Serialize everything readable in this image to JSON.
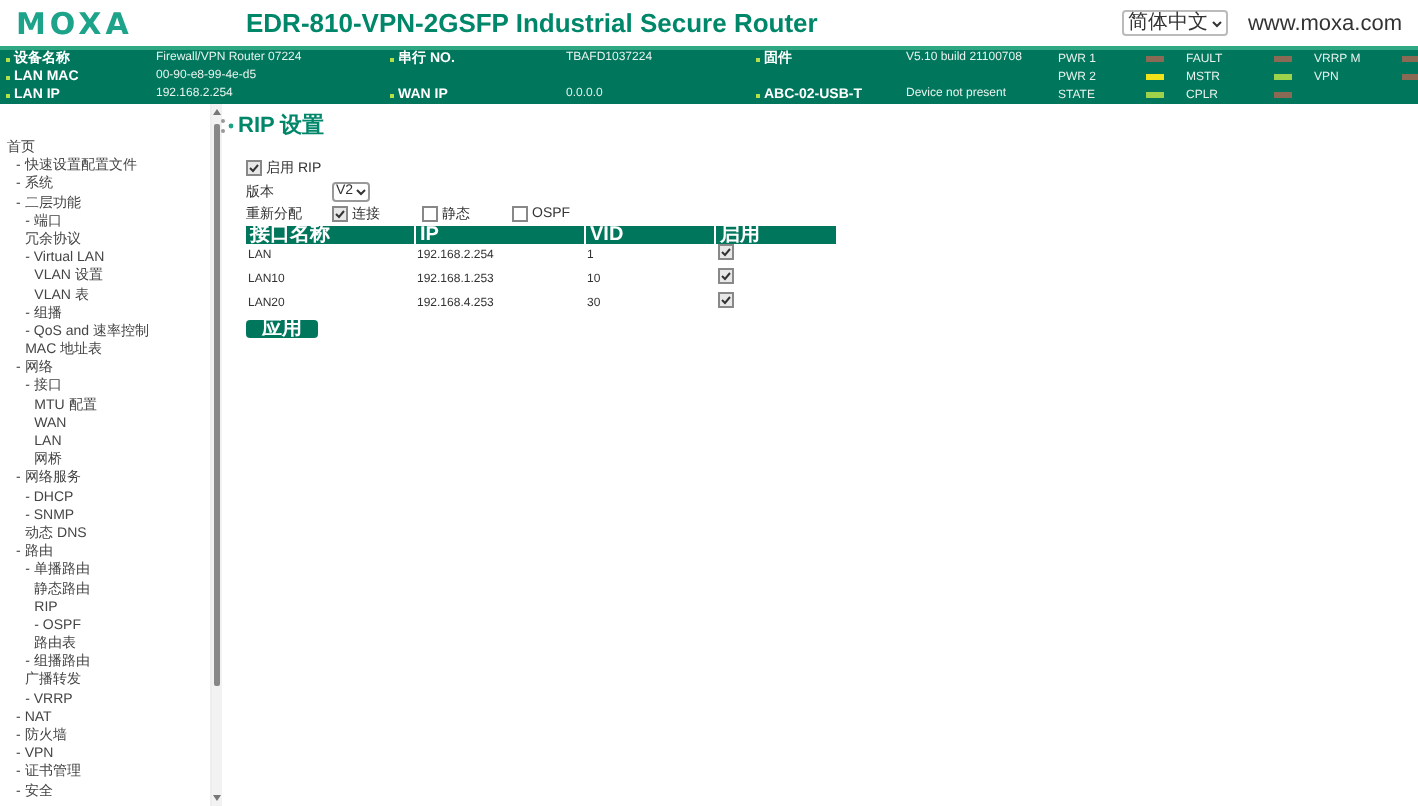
{
  "header": {
    "logo": "MOXA",
    "title": "EDR-810-VPN-2GSFP Industrial Secure Router",
    "language": "简体中文",
    "website": "www.moxa.com"
  },
  "info_rows": [
    [
      {
        "label": "设备名称",
        "value": "Firewall/VPN Router 07224"
      },
      {
        "label": "串行 NO.",
        "value": "TBAFD1037224"
      },
      {
        "label": "固件",
        "value": "V5.10 build 21100708"
      }
    ],
    [
      {
        "label": "LAN MAC",
        "value": "00-90-e8-99-4e-d5"
      }
    ],
    [
      {
        "label": "LAN IP",
        "value": "192.168.2.254"
      },
      {
        "label": "WAN IP",
        "value": "0.0.0.0"
      },
      {
        "label": "ABC-02-USB-T",
        "value": "Device not present"
      }
    ]
  ],
  "leds": [
    [
      {
        "label": "PWR 1",
        "color": "#8a6a55"
      },
      {
        "label": "PWR 2",
        "color": "#f2e21a"
      },
      {
        "label": "STATE",
        "color": "#9ed24a"
      }
    ],
    [
      {
        "label": "FAULT",
        "color": "#8a6a55"
      },
      {
        "label": "MSTR",
        "color": "#9ed24a"
      },
      {
        "label": "CPLR",
        "color": "#8a6a55"
      }
    ],
    [
      {
        "label": "VRRP M",
        "color": "#8a6a55"
      },
      {
        "label": "VPN",
        "color": "#8a6a55"
      }
    ]
  ],
  "sidebar": {
    "items": [
      {
        "label": "首页",
        "children": [
          {
            "label": "- 快速设置配置文件"
          },
          {
            "label": "- 系统"
          },
          {
            "label": "- 二层功能",
            "children": [
              {
                "label": "- 端口"
              },
              {
                "label": "冗余协议"
              },
              {
                "label": "- Virtual LAN",
                "children": [
                  {
                    "label": "VLAN 设置"
                  },
                  {
                    "label": "VLAN 表"
                  }
                ]
              },
              {
                "label": "- 组播"
              },
              {
                "label": "- QoS and 速率控制"
              },
              {
                "label": "MAC 地址表"
              }
            ]
          },
          {
            "label": "- 网络",
            "children": [
              {
                "label": "- 接口",
                "children": [
                  {
                    "label": "MTU 配置"
                  },
                  {
                    "label": "WAN"
                  },
                  {
                    "label": "LAN"
                  },
                  {
                    "label": "网桥"
                  }
                ]
              }
            ]
          },
          {
            "label": "- 网络服务",
            "children": [
              {
                "label": "- DHCP"
              },
              {
                "label": "- SNMP"
              },
              {
                "label": "动态 DNS"
              }
            ]
          },
          {
            "label": "- 路由",
            "children": [
              {
                "label": "- 单播路由",
                "children": [
                  {
                    "label": "静态路由"
                  },
                  {
                    "label": "RIP"
                  },
                  {
                    "label": "- OSPF"
                  },
                  {
                    "label": "路由表"
                  }
                ]
              },
              {
                "label": "- 组播路由"
              },
              {
                "label": "广播转发"
              },
              {
                "label": "- VRRP"
              }
            ]
          },
          {
            "label": "- NAT"
          },
          {
            "label": "- 防火墙"
          },
          {
            "label": "- VPN"
          },
          {
            "label": "- 证书管理"
          },
          {
            "label": "- 安全"
          }
        ]
      }
    ]
  },
  "page": {
    "title": "RIP 设置",
    "enable": {
      "label": "启用 RIP",
      "checked": true
    },
    "version": {
      "label": "版本",
      "value": "V2"
    },
    "redistribute": {
      "label": "重新分配",
      "options": [
        {
          "label": "连接",
          "checked": true
        },
        {
          "label": "静态",
          "checked": false
        },
        {
          "label": "OSPF",
          "checked": false
        }
      ]
    },
    "table": {
      "columns": [
        "接口名称",
        "IP",
        "VID",
        "启用"
      ],
      "rows": [
        {
          "name": "LAN",
          "ip": "192.168.2.254",
          "vid": "1",
          "enabled": true
        },
        {
          "name": "LAN10",
          "ip": "192.168.1.253",
          "vid": "10",
          "enabled": true
        },
        {
          "name": "LAN20",
          "ip": "192.168.4.253",
          "vid": "30",
          "enabled": true
        }
      ]
    },
    "apply_button": "应用"
  }
}
